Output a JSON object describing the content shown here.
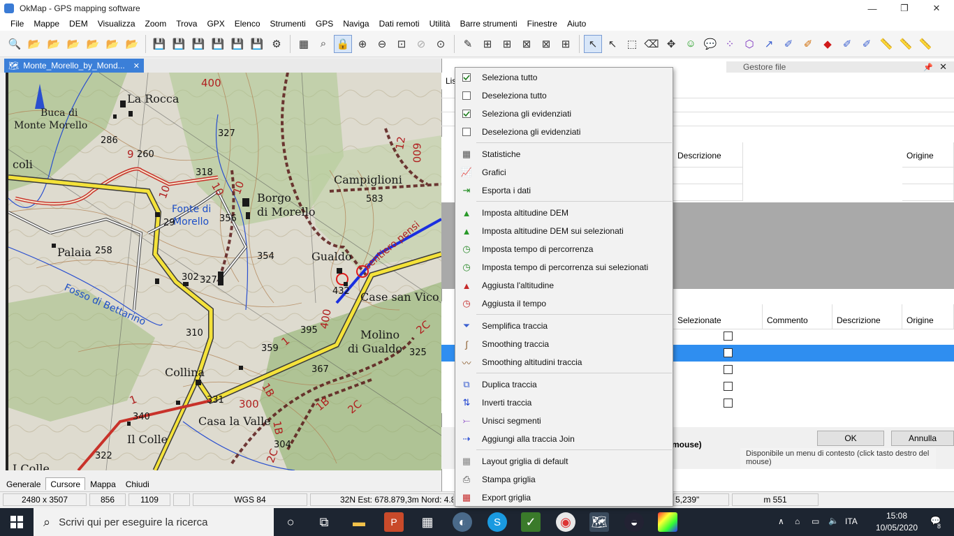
{
  "window": {
    "title": "OkMap - GPS mapping software",
    "controls": [
      "—",
      "❐",
      "✕"
    ]
  },
  "menu": [
    "File",
    "Mappe",
    "DEM",
    "Visualizza",
    "Zoom",
    "Trova",
    "GPX",
    "Elenco",
    "Strumenti",
    "GPS",
    "Naviga",
    "Dati remoti",
    "Utilità",
    "Barre strumenti",
    "Finestre",
    "Aiuto"
  ],
  "doc_tab": {
    "label": "Monte_Morello_by_Mond...",
    "close": "✕"
  },
  "right_panel": {
    "header_title": "Gestore file",
    "list_label": "Lis",
    "upper_grid_headers": [
      "Descrizione",
      "Origine"
    ],
    "lower_grid_headers": [
      "Selezionate",
      "Commento",
      "Descrizione",
      "Origine"
    ],
    "bold_hint": "mouse)",
    "hint_text": "Disponibile un menu di contesto (click tasto destro del mouse)",
    "ok_label": "OK",
    "cancel_label": "Annulla"
  },
  "map": {
    "place_labels": [
      "La Rocca",
      "Buca di",
      "Monte Morello",
      "coli",
      "Palaia",
      "Borgo",
      "di Morello",
      "Campiglioni",
      "Gualdo",
      "Case san Vico",
      "Molino",
      "di Gualdo",
      "Collina",
      "Casa la Valle",
      "Il Colle",
      "I Colle"
    ],
    "blue_labels": [
      "Fonte di",
      "Morello",
      "Fosso di Bettarino"
    ],
    "elevations": [
      "400",
      "327",
      "286",
      "260",
      "318",
      "356",
      "258",
      "354",
      "302",
      "327",
      "310",
      "359",
      "395",
      "432",
      "583",
      "367",
      "325",
      "340",
      "331",
      "300",
      "304",
      "322",
      "29"
    ],
    "trail_labels": [
      "9",
      "10",
      "10",
      "10",
      "12",
      "600",
      "1",
      "1",
      "1B",
      "1B",
      "1B",
      "2C",
      "2C",
      "2C",
      "400",
      "sentiero pensi"
    ]
  },
  "bottom_tabs": [
    "Generale",
    "Cursore",
    "Mappa",
    "Chiudi"
  ],
  "status": {
    "size": "2480 x 3507",
    "x": "856",
    "y": "1109",
    "blank": "",
    "datum": "WGS 84",
    "utm": "32N  Est: 678.879,3m  Nord: 4.8",
    "coord": "5,239\"",
    "alt": "m 551"
  },
  "context_menu": {
    "items": [
      {
        "label": "Seleziona tutto",
        "icon": "checkbox-checked-icon"
      },
      {
        "label": "Deseleziona tutto",
        "icon": "checkbox-empty-icon"
      },
      {
        "label": "Seleziona gli evidenziati",
        "icon": "checkbox-checked-icon"
      },
      {
        "label": "Deseleziona gli evidenziati",
        "icon": "checkbox-empty-icon"
      },
      {
        "label": "Statistiche",
        "icon": "calculator-icon"
      },
      {
        "label": "Grafici",
        "icon": "chart-icon"
      },
      {
        "label": "Esporta i dati",
        "icon": "export-icon"
      },
      {
        "label": "Imposta altitudine DEM",
        "icon": "mountain-icon"
      },
      {
        "label": "Imposta altitudine DEM sui selezionati",
        "icon": "mountain-icon"
      },
      {
        "label": "Imposta tempo di percorrenza",
        "icon": "clock-icon"
      },
      {
        "label": "Imposta tempo di percorrenza sui selezionati",
        "icon": "clock-icon"
      },
      {
        "label": "Aggiusta l'altitudine",
        "icon": "mountain-red-icon"
      },
      {
        "label": "Aggiusta il tempo",
        "icon": "clock-red-icon"
      },
      {
        "label": "Semplifica traccia",
        "icon": "funnel-icon"
      },
      {
        "label": "Smoothing traccia",
        "icon": "curve-icon"
      },
      {
        "label": "Smoothing altitudini traccia",
        "icon": "altitude-curve-icon"
      },
      {
        "label": "Duplica traccia",
        "icon": "duplicate-icon"
      },
      {
        "label": "Inverti traccia",
        "icon": "reverse-arrows-icon"
      },
      {
        "label": "Unisci segmenti",
        "icon": "merge-icon"
      },
      {
        "label": "Aggiungi alla traccia Join",
        "icon": "add-join-icon"
      },
      {
        "label": "Layout griglia di default",
        "icon": "grid-icon"
      },
      {
        "label": "Stampa griglia",
        "icon": "printer-icon"
      },
      {
        "label": "Export griglia",
        "icon": "grid-export-icon"
      }
    ]
  },
  "taskbar": {
    "search_placeholder": "Scrivi qui per eseguire la ricerca",
    "language": "ITA",
    "time": "15:08",
    "date": "10/05/2020",
    "notifications": "8"
  }
}
